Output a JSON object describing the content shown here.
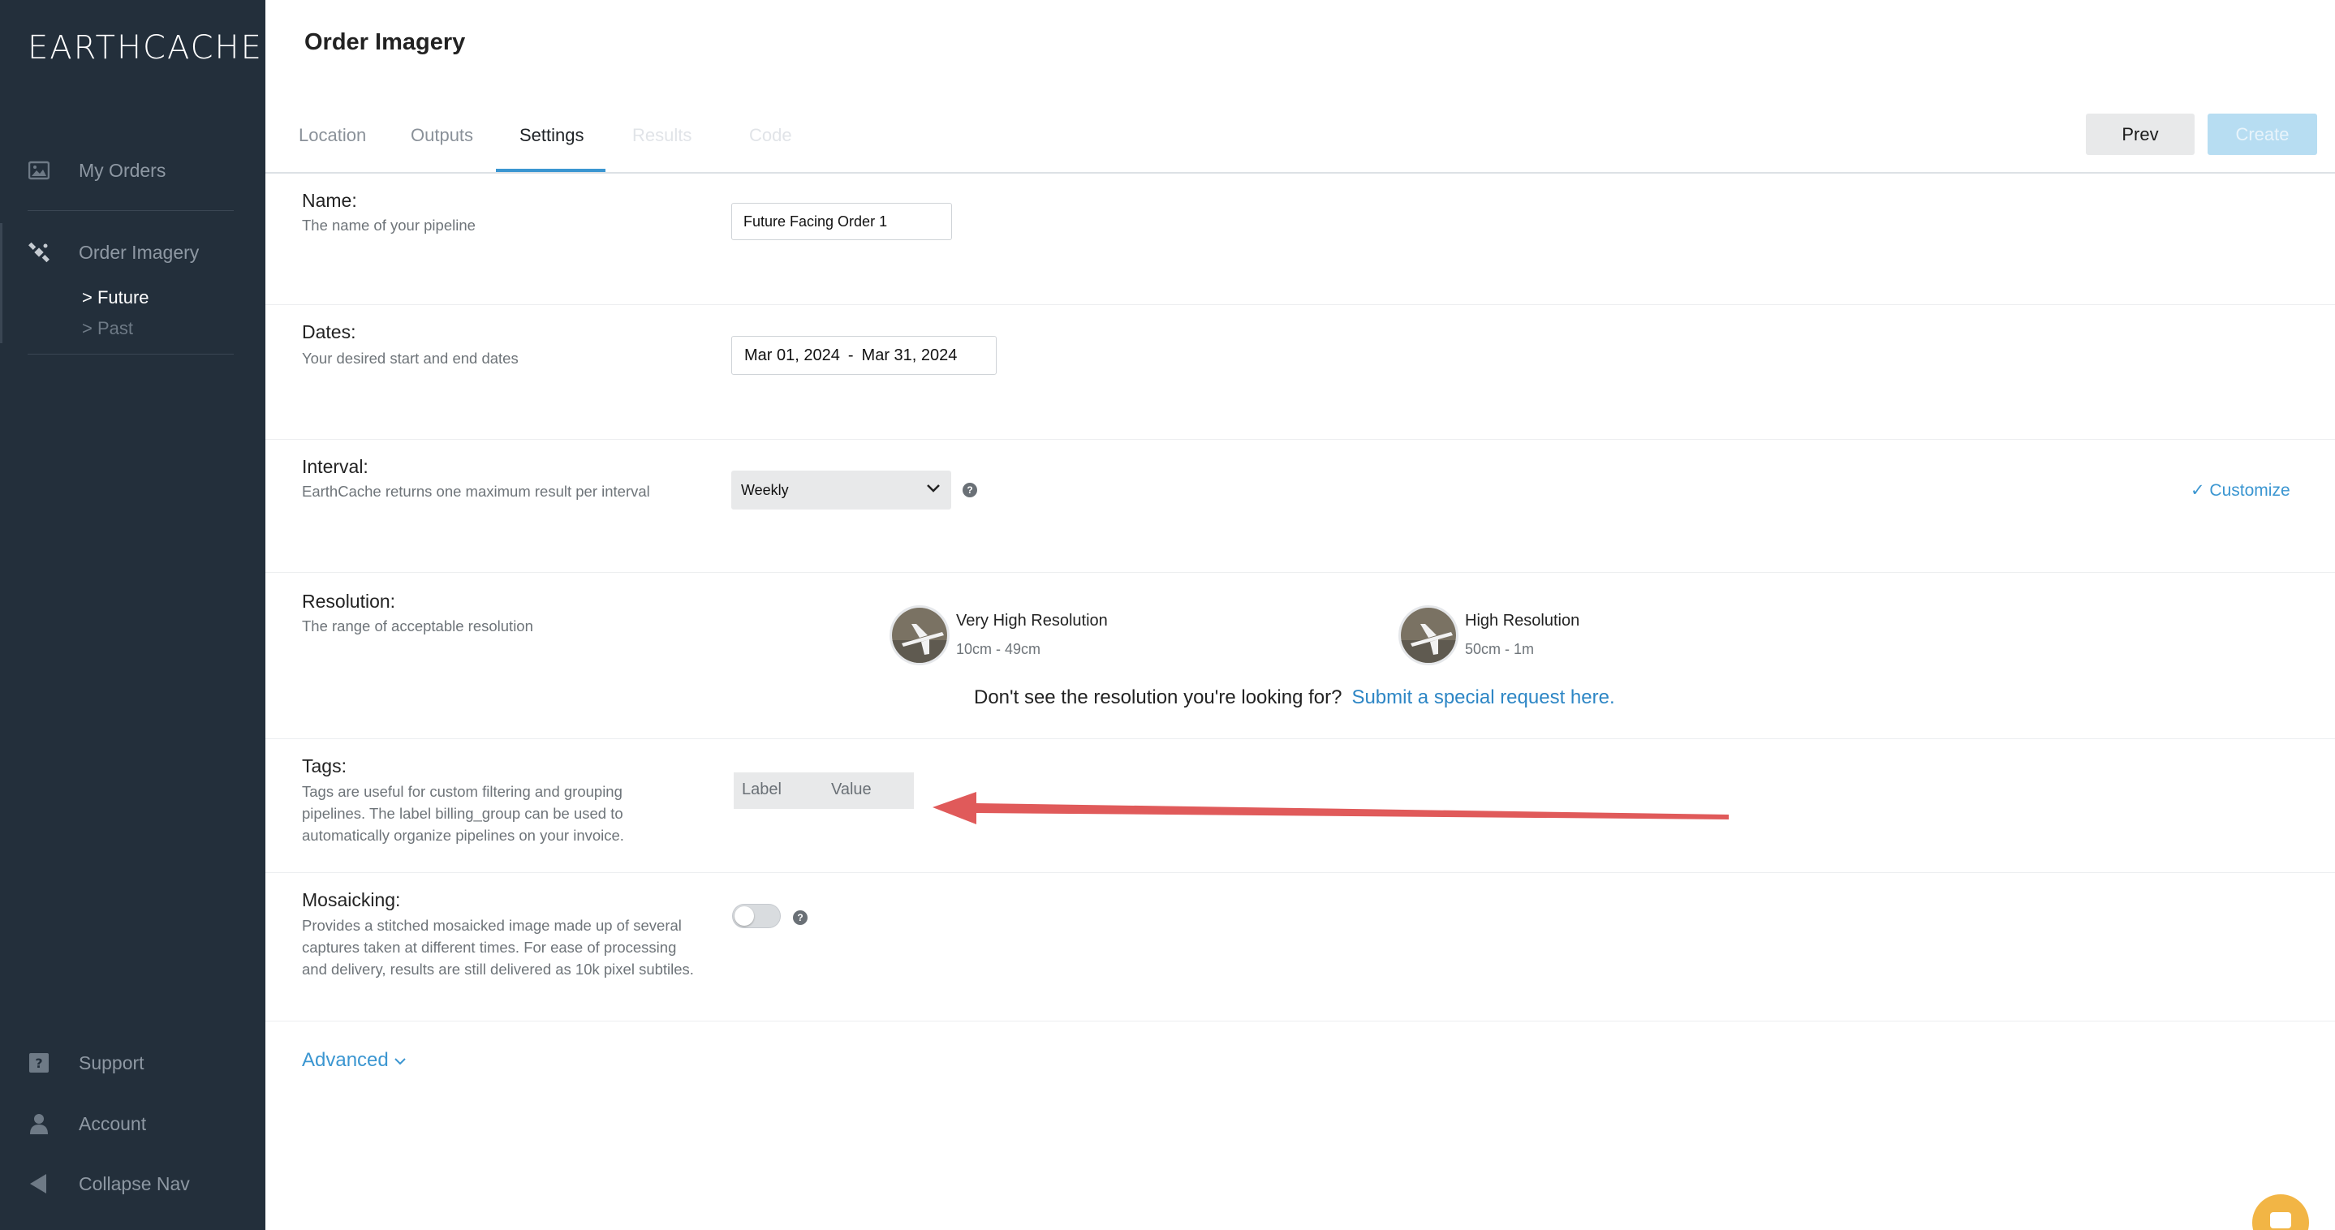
{
  "sidebar": {
    "logo": "EARTHCACHE",
    "items": [
      {
        "label": "My Orders",
        "icon": "image-icon"
      },
      {
        "label": "Order Imagery",
        "icon": "satellite-icon"
      }
    ],
    "sub_items": [
      {
        "label": "> Future"
      },
      {
        "label": "> Past"
      }
    ],
    "bottom_items": [
      {
        "label": "Support",
        "icon": "question-icon"
      },
      {
        "label": "Account",
        "icon": "user-icon"
      },
      {
        "label": "Collapse Nav",
        "icon": "collapse-arrow-icon"
      }
    ]
  },
  "header": {
    "title": "Order Imagery",
    "tabs": [
      {
        "label": "Location"
      },
      {
        "label": "Outputs"
      },
      {
        "label": "Settings",
        "active": true
      },
      {
        "label": "Results",
        "disabled": true
      },
      {
        "label": "Code",
        "disabled": true
      }
    ],
    "prev_label": "Prev",
    "create_label": "Create"
  },
  "form": {
    "name": {
      "title": "Name:",
      "desc": "The name of your pipeline",
      "value": "Future Facing Order 1"
    },
    "dates": {
      "title": "Dates:",
      "desc": "Your desired start and end dates",
      "start": "Mar 01, 2024",
      "separator": "-",
      "end": "Mar 31, 2024"
    },
    "interval": {
      "title": "Interval:",
      "desc": "EarthCache returns one maximum result per interval",
      "value": "Weekly",
      "customize": "✓ Customize"
    },
    "resolution": {
      "title": "Resolution:",
      "desc": "The range of acceptable resolution",
      "options": [
        {
          "name": "Very High Resolution",
          "range": "10cm - 49cm"
        },
        {
          "name": "High Resolution",
          "range": "50cm - 1m"
        }
      ],
      "note": "Don't see the resolution you're looking for?",
      "link": "Submit a special request here."
    },
    "tags": {
      "title": "Tags:",
      "desc": "Tags are useful for custom filtering and grouping pipelines. The label billing_group can be used to automatically organize pipelines on your invoice.",
      "col_label": "Label",
      "col_value": "Value"
    },
    "mosaicking": {
      "title": "Mosaicking:",
      "desc": "Provides a stitched mosaicked image made up of several captures taken at different times. For ease of processing and delivery, results are still delivered as 10k pixel subtiles.",
      "enabled": false
    },
    "advanced_label": "Advanced"
  },
  "colors": {
    "sidebar_bg": "#232f3b",
    "accent": "#3b96d1",
    "annotation_arrow": "#e05a5a",
    "chat_bubble": "#f2b545"
  }
}
